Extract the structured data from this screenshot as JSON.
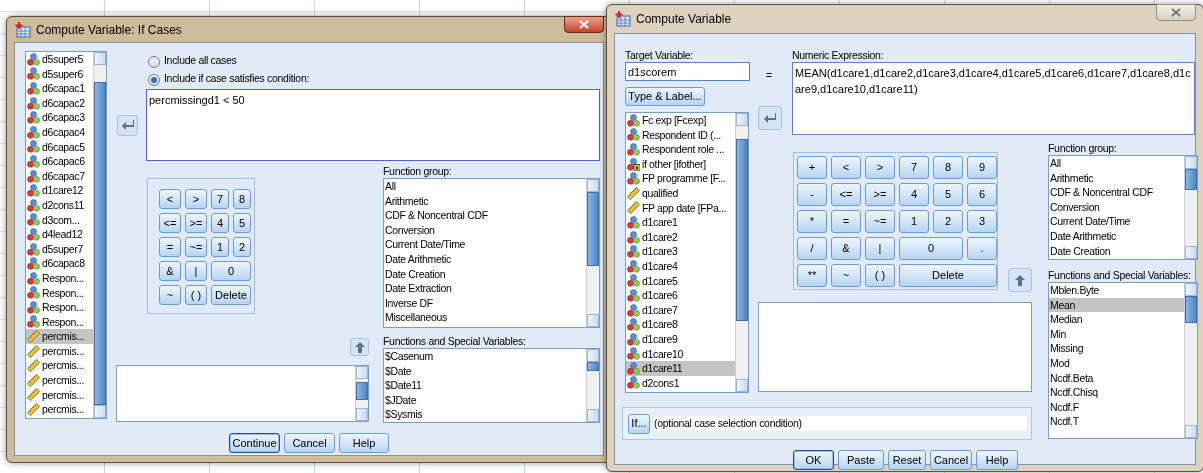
{
  "if_cases_dialog": {
    "title": "Compute Variable: If Cases",
    "active": true,
    "variables": [
      {
        "label": "d5super5",
        "kind": "nominal",
        "selected": false
      },
      {
        "label": "d5super6",
        "kind": "nominal",
        "selected": false
      },
      {
        "label": "d6capac1",
        "kind": "nominal",
        "selected": false
      },
      {
        "label": "d6capac2",
        "kind": "nominal",
        "selected": false
      },
      {
        "label": "d6capac3",
        "kind": "nominal",
        "selected": false
      },
      {
        "label": "d6capac4",
        "kind": "nominal",
        "selected": false
      },
      {
        "label": "d6capac5",
        "kind": "nominal",
        "selected": false
      },
      {
        "label": "d6capac6",
        "kind": "nominal",
        "selected": false
      },
      {
        "label": "d6capac7",
        "kind": "nominal",
        "selected": false
      },
      {
        "label": "d1care12",
        "kind": "nominal",
        "selected": false
      },
      {
        "label": "d2cons11",
        "kind": "nominal",
        "selected": false
      },
      {
        "label": "d3com...",
        "kind": "nominal",
        "selected": false
      },
      {
        "label": "d4lead12",
        "kind": "nominal",
        "selected": false
      },
      {
        "label": "d5super7",
        "kind": "nominal",
        "selected": false
      },
      {
        "label": "d6capac8",
        "kind": "nominal",
        "selected": false
      },
      {
        "label": "Respon...",
        "kind": "nominal",
        "selected": false
      },
      {
        "label": "Respon...",
        "kind": "nominal",
        "selected": false
      },
      {
        "label": "Respon...",
        "kind": "nominal",
        "selected": false
      },
      {
        "label": "Respon...",
        "kind": "nominal",
        "selected": false
      },
      {
        "label": "percmis...",
        "kind": "scale",
        "selected": true
      },
      {
        "label": "percmis...",
        "kind": "scale",
        "selected": false
      },
      {
        "label": "percmis...",
        "kind": "scale",
        "selected": false
      },
      {
        "label": "percmis...",
        "kind": "scale",
        "selected": false
      },
      {
        "label": "percmis...",
        "kind": "scale",
        "selected": false
      },
      {
        "label": "percmis...",
        "kind": "scale",
        "selected": false
      }
    ],
    "options": [
      {
        "label": "Include all cases",
        "selected": false
      },
      {
        "label": "Include if case satisfies condition:",
        "selected": true
      }
    ],
    "condition": "percmissingd1 < 50",
    "keypad": [
      {
        "label": "<",
        "kind": "key"
      },
      {
        "label": ">",
        "kind": "key"
      },
      {
        "label": "7",
        "kind": "key"
      },
      {
        "label": "8",
        "kind": "key"
      },
      {
        "label": "<=",
        "kind": "key"
      },
      {
        "label": ">=",
        "kind": "key"
      },
      {
        "label": "4",
        "kind": "key"
      },
      {
        "label": "5",
        "kind": "key"
      },
      {
        "label": "=",
        "kind": "key"
      },
      {
        "label": "~=",
        "kind": "key"
      },
      {
        "label": "1",
        "kind": "key"
      },
      {
        "label": "2",
        "kind": "key"
      },
      {
        "label": "&",
        "kind": "key"
      },
      {
        "label": "|",
        "kind": "key"
      },
      {
        "label": "0",
        "kind": "zero"
      },
      {
        "label": "~",
        "kind": "key"
      },
      {
        "label": "( )",
        "kind": "key"
      },
      {
        "label": "Delete",
        "kind": "delete"
      }
    ],
    "function_group": {
      "label": "Function group:",
      "items": [
        "All",
        "Arithmetic",
        "CDF & Noncentral CDF",
        "Conversion",
        "Current Date/Time",
        "Date Arithmetic",
        "Date Creation",
        "Date Extraction",
        "Inverse DF",
        "Miscellaneous"
      ]
    },
    "functions": {
      "label": "Functions and Special Variables:",
      "items": [
        {
          "label": "$Casenum",
          "selected": false
        },
        {
          "label": "$Date",
          "selected": false
        },
        {
          "label": "$Date11",
          "selected": false
        },
        {
          "label": "$JDate",
          "selected": false
        },
        {
          "label": "$Sysmis",
          "selected": false
        }
      ]
    },
    "buttons": [
      {
        "label": "Continue",
        "default": true
      },
      {
        "label": "Cancel",
        "default": false
      },
      {
        "label": "Help",
        "default": false
      }
    ]
  },
  "compute_dialog": {
    "title": "Compute Variable",
    "active": false,
    "target_label": "Target Variable:",
    "target_value": "d1scorem",
    "equals": "=",
    "type_label_button": "Type & Label...",
    "variables": [
      {
        "label": "Fc exp [Fcexp]",
        "kind": "nominal",
        "selected": false
      },
      {
        "label": "Respondent ID (...",
        "kind": "nominal",
        "selected": false
      },
      {
        "label": "Respondent role ...",
        "kind": "nominal",
        "selected": false
      },
      {
        "label": "if other [ifother]",
        "kind": "string",
        "selected": false
      },
      {
        "label": "FP programme [F...",
        "kind": "nominal",
        "selected": false
      },
      {
        "label": "qualified",
        "kind": "scale",
        "selected": false
      },
      {
        "label": "FP app date [FPa...",
        "kind": "scale",
        "selected": false
      },
      {
        "label": "d1care1",
        "kind": "nominal",
        "selected": false
      },
      {
        "label": "d1care2",
        "kind": "nominal",
        "selected": false
      },
      {
        "label": "d1care3",
        "kind": "nominal",
        "selected": false
      },
      {
        "label": "d1care4",
        "kind": "nominal",
        "selected": false
      },
      {
        "label": "d1care5",
        "kind": "nominal",
        "selected": false
      },
      {
        "label": "d1care6",
        "kind": "nominal",
        "selected": false
      },
      {
        "label": "d1care7",
        "kind": "nominal",
        "selected": false
      },
      {
        "label": "d1care8",
        "kind": "nominal",
        "selected": false
      },
      {
        "label": "d1care9",
        "kind": "nominal",
        "selected": false
      },
      {
        "label": "d1care10",
        "kind": "nominal",
        "selected": false
      },
      {
        "label": "d1care11",
        "kind": "nominal",
        "selected": true
      },
      {
        "label": "d2cons1",
        "kind": "nominal",
        "selected": false
      }
    ],
    "expression_label": "Numeric Expression:",
    "expression": "MEAN(d1care1,d1care2,d1care3,d1care4,d1care5,d1care6,d1care7,d1care8,d1care9,d1care10,d1care11)",
    "keypad": [
      {
        "label": "+",
        "kind": "key"
      },
      {
        "label": "<",
        "kind": "key"
      },
      {
        "label": ">",
        "kind": "key"
      },
      {
        "label": "7",
        "kind": "key"
      },
      {
        "label": "8",
        "kind": "key"
      },
      {
        "label": "9",
        "kind": "key"
      },
      {
        "label": "-",
        "kind": "key"
      },
      {
        "label": "<=",
        "kind": "key"
      },
      {
        "label": ">=",
        "kind": "key"
      },
      {
        "label": "4",
        "kind": "key"
      },
      {
        "label": "5",
        "kind": "key"
      },
      {
        "label": "6",
        "kind": "key"
      },
      {
        "label": "*",
        "kind": "key"
      },
      {
        "label": "=",
        "kind": "key"
      },
      {
        "label": "~=",
        "kind": "key"
      },
      {
        "label": "1",
        "kind": "key"
      },
      {
        "label": "2",
        "kind": "key"
      },
      {
        "label": "3",
        "kind": "key"
      },
      {
        "label": "/",
        "kind": "key"
      },
      {
        "label": "&",
        "kind": "key"
      },
      {
        "label": "|",
        "kind": "key"
      },
      {
        "label": "0",
        "kind": "zero"
      },
      {
        "label": ".",
        "kind": "key"
      },
      {
        "label": "**",
        "kind": "key"
      },
      {
        "label": "~",
        "kind": "key"
      },
      {
        "label": "( )",
        "kind": "key"
      },
      {
        "label": "Delete",
        "kind": "delete"
      }
    ],
    "function_group": {
      "label": "Function group:",
      "items": [
        "All",
        "Arithmetic",
        "CDF & Noncentral CDF",
        "Conversion",
        "Current Date/Time",
        "Date Arithmetic",
        "Date Creation"
      ]
    },
    "functions": {
      "label": "Functions and Special Variables:",
      "items": [
        {
          "label": "Mblen.Byte",
          "selected": false
        },
        {
          "label": "Mean",
          "selected": true
        },
        {
          "label": "Median",
          "selected": false
        },
        {
          "label": "Min",
          "selected": false
        },
        {
          "label": "Missing",
          "selected": false
        },
        {
          "label": "Mod",
          "selected": false
        },
        {
          "label": "Ncdf.Beta",
          "selected": false
        },
        {
          "label": "Ncdf.Chisq",
          "selected": false
        },
        {
          "label": "Ncdf.F",
          "selected": false
        },
        {
          "label": "Ncdf.T",
          "selected": false
        }
      ]
    },
    "if_button": "If...",
    "if_condition": "(optional case selection condition)",
    "buttons": [
      {
        "label": "OK",
        "default": true
      },
      {
        "label": "Paste",
        "default": false
      },
      {
        "label": "Reset",
        "default": false
      },
      {
        "label": "Cancel",
        "default": false
      },
      {
        "label": "Help",
        "default": false
      }
    ]
  }
}
